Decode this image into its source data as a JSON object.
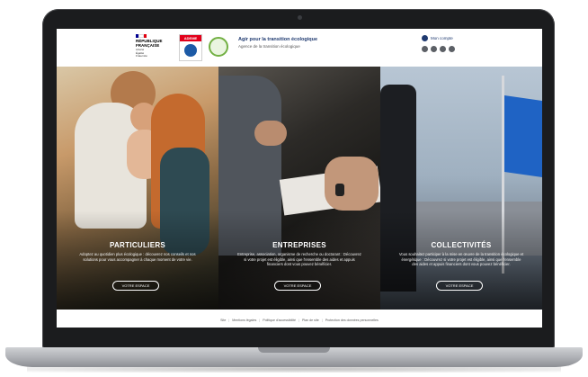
{
  "header": {
    "republic_lines": [
      "RÉPUBLIQUE",
      "FRANÇAISE"
    ],
    "republic_motto": [
      "Liberté",
      "Égalité",
      "Fraternité"
    ],
    "ademe_label": "ADEME",
    "title": "Agir pour la transition écologique",
    "subtitle": "Agence de la transition écologique",
    "connect_label": "Mon compte",
    "socials": [
      "twitter-icon",
      "facebook-icon",
      "linkedin-icon",
      "youtube-icon"
    ]
  },
  "panels": [
    {
      "title": "PARTICULIERS",
      "text": "Adoptez au quotidien plus écologique : découvrez nos conseils et nos solutions pour vous accompagner à chaque moment de votre vie.",
      "button": "VOTRE ESPACE"
    },
    {
      "title": "ENTREPRISES",
      "text": "Entreprise, association, organisme de recherche ou doctorant : Découvrez si votre projet est éligible, ainsi que l'ensemble des aides et appuis financiers dont vous pouvez bénéficier.",
      "button": "VOTRE ESPACE"
    },
    {
      "title": "COLLECTIVITÉS",
      "text": "Vous souhaitez participer à la mise en œuvre de la transition écologique et énergétique : Découvrez si votre projet est éligible, ainsi que l'ensemble des aides et appuis financiers dont vous pouvez bénéficier.",
      "button": "VOTRE ESPACE"
    }
  ],
  "footer": {
    "links": [
      "Site",
      "Mentions légales",
      "Politique d'accessibilité",
      "Plan de site",
      "Protection des données personnelles"
    ]
  },
  "colors": {
    "brand_blue": "#1f3a70",
    "ademe_red": "#e2001a",
    "flag_blue": "#1f63c4"
  }
}
